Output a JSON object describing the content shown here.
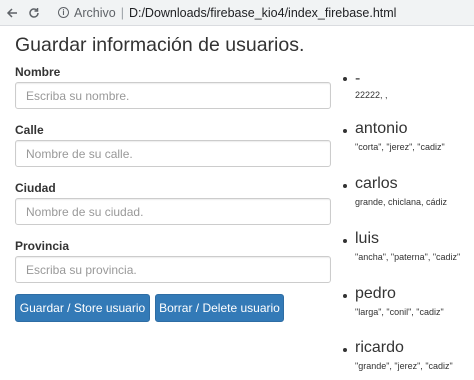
{
  "browser": {
    "chip_label": "Archivo",
    "separator": "|",
    "url": "D:/Downloads/firebase_kio4/index_firebase.html"
  },
  "page": {
    "title": "Guardar información de usuarios."
  },
  "form": {
    "nombre": {
      "label": "Nombre",
      "placeholder": "Escriba su nombre.",
      "value": ""
    },
    "calle": {
      "label": "Calle",
      "placeholder": "Nombre de su calle.",
      "value": ""
    },
    "ciudad": {
      "label": "Ciudad",
      "placeholder": "Nombre de su ciudad.",
      "value": ""
    },
    "provincia": {
      "label": "Provincia",
      "placeholder": "Escriba su provincia.",
      "value": ""
    },
    "store_button": "Guardar / Store usuario",
    "delete_button": "Borrar / Delete usuario"
  },
  "users": [
    {
      "name": "-",
      "detail": "22222, ,"
    },
    {
      "name": "antonio",
      "detail": "\"corta\", \"jerez\", \"cadiz\""
    },
    {
      "name": "carlos",
      "detail": "grande, chiclana, cádiz"
    },
    {
      "name": "luis",
      "detail": "\"ancha\", \"paterna\", \"cadiz\""
    },
    {
      "name": "pedro",
      "detail": "\"larga\", \"conil\", \"cadiz\""
    },
    {
      "name": "ricardo",
      "detail": "\"grande\", \"jerez\", \"cadiz\""
    }
  ],
  "colors": {
    "primary_button": "#337ab7",
    "text": "#333333"
  }
}
